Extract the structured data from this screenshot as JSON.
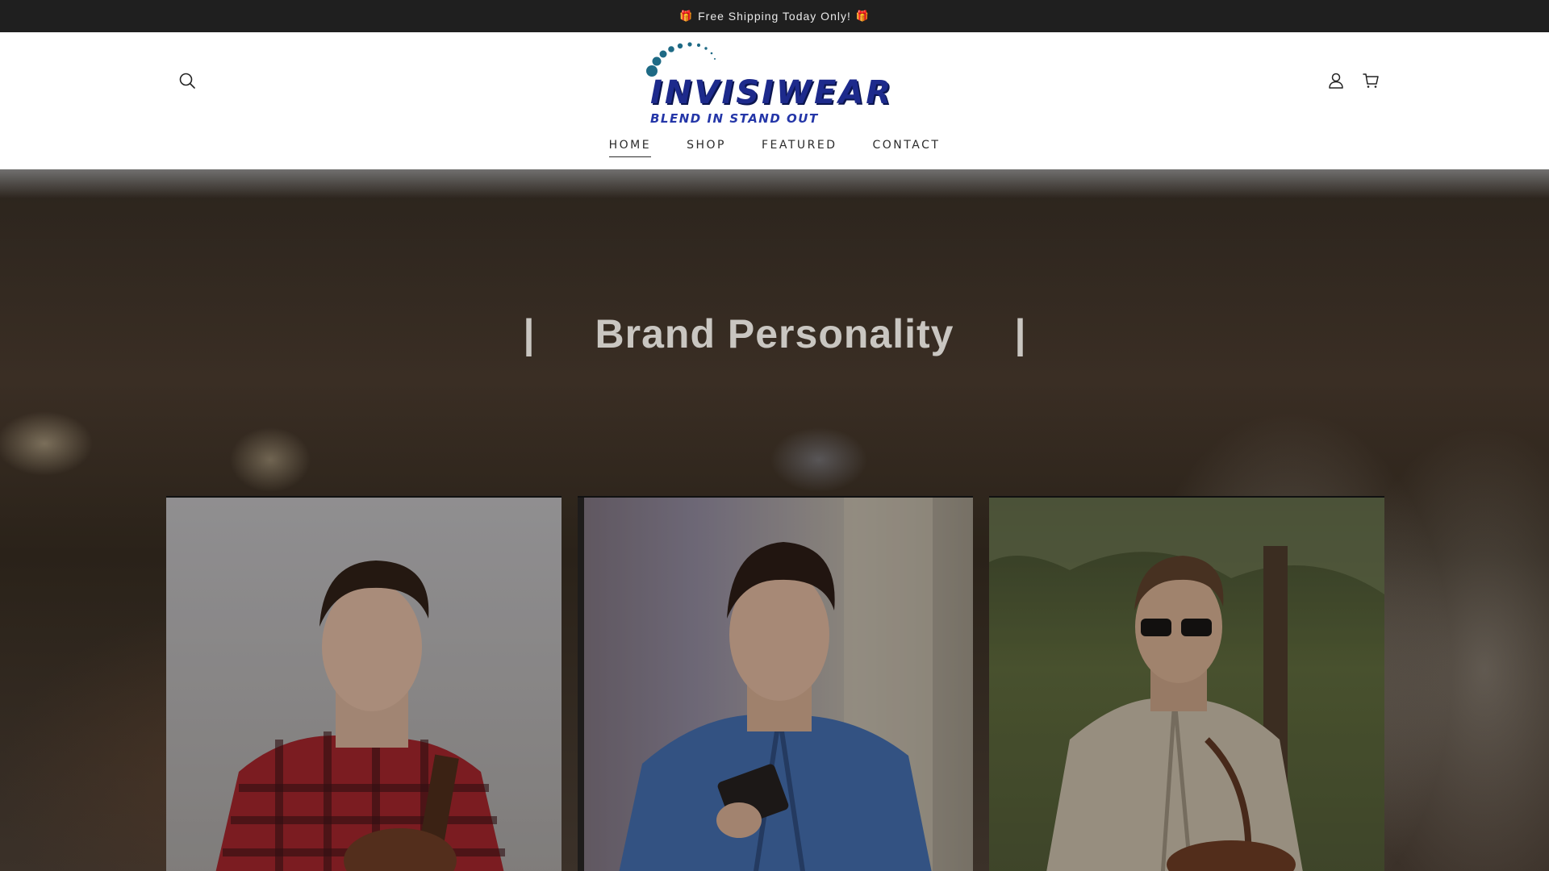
{
  "announcement": {
    "text": "Free Shipping Today Only!",
    "gift_icon": "gift-icon"
  },
  "header": {
    "logo": {
      "wordmark": "INVISIWEAR",
      "tagline": "BLEND IN STAND OUT"
    },
    "icons": {
      "search": "search-icon",
      "account": "user-icon",
      "cart": "cart-icon"
    },
    "nav": [
      {
        "label": "HOME",
        "active": true
      },
      {
        "label": "SHOP",
        "active": false
      },
      {
        "label": "FEATURED",
        "active": false
      },
      {
        "label": "CONTACT",
        "active": false
      }
    ]
  },
  "hero": {
    "title": "Brand Personality",
    "divider": "|",
    "photos": [
      {
        "name": "model-red-plaid-shirt"
      },
      {
        "name": "model-denim-jacket-wallet"
      },
      {
        "name": "model-khaki-jacket-sunglasses"
      }
    ]
  },
  "colors": {
    "announcement_bg": "#1f1f1f",
    "logo_blue": "#1d2a8c",
    "logo_teal": "#1e6a85"
  }
}
